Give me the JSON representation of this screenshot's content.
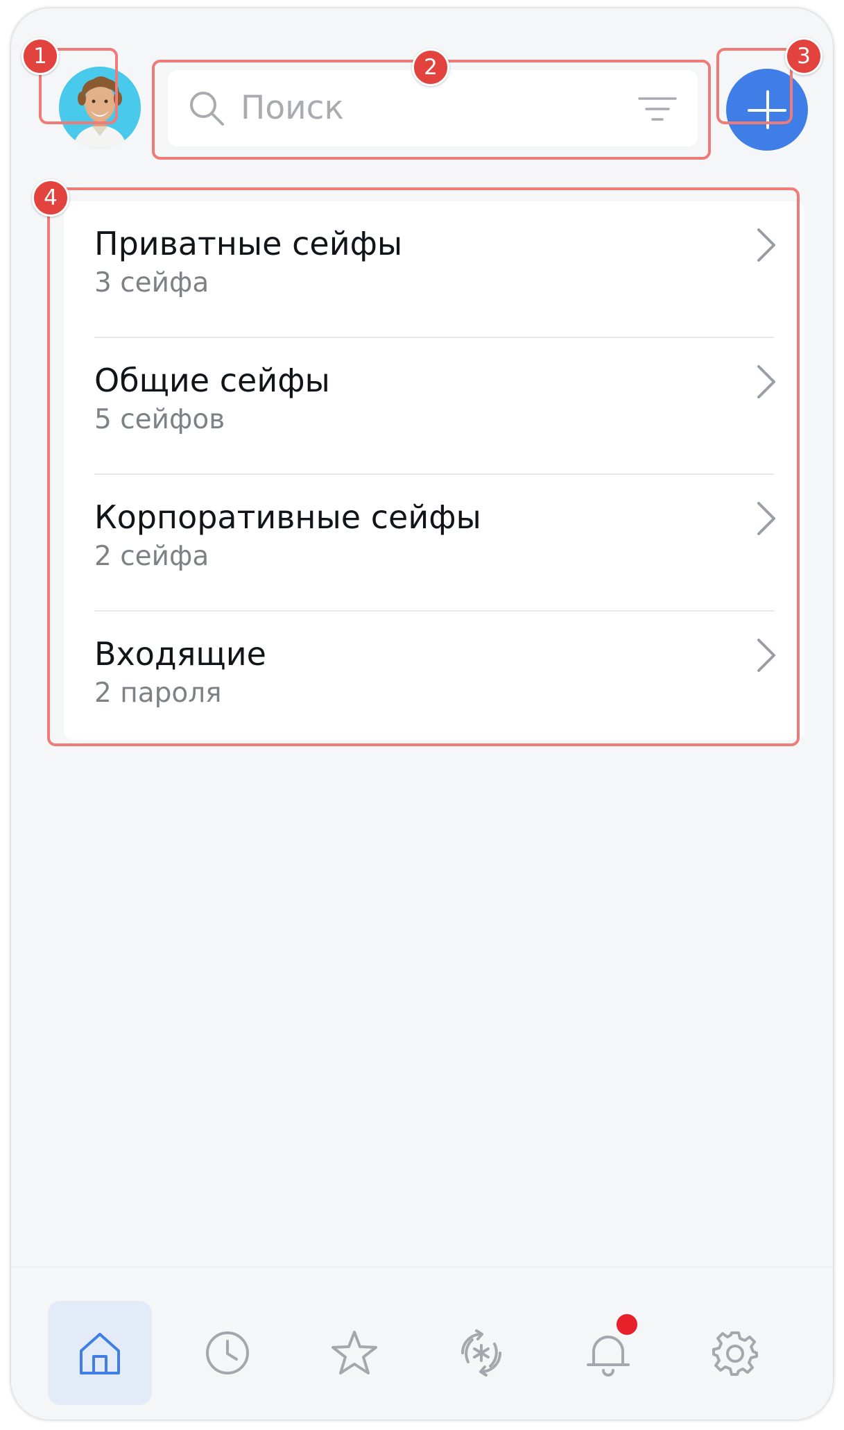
{
  "header": {
    "avatar_label": "",
    "search": {
      "placeholder": "Поиск"
    }
  },
  "callouts": [
    "1",
    "2",
    "3",
    "4"
  ],
  "vaults": [
    {
      "title": "Приватные сейфы",
      "subtitle": "3 сейфа"
    },
    {
      "title": "Общие сейфы",
      "subtitle": "5 сейфов"
    },
    {
      "title": "Корпоративные сейфы",
      "subtitle": "2 сейфа"
    },
    {
      "title": "Входящие",
      "subtitle": "2 пароля"
    }
  ],
  "tabbar": {
    "items": [
      {
        "icon": "home-icon",
        "active": true
      },
      {
        "icon": "clock-icon",
        "active": false
      },
      {
        "icon": "star-icon",
        "active": false
      },
      {
        "icon": "password-generator-icon",
        "active": false
      },
      {
        "icon": "bell-icon",
        "active": false,
        "has_notification": true
      },
      {
        "icon": "gear-icon",
        "active": false
      }
    ]
  },
  "colors": {
    "accent": "#3f7ee6",
    "highlight_border": "#ee7b78",
    "badge": "#e2433f",
    "notification": "#e8202a",
    "background": "#f5f6f8"
  }
}
